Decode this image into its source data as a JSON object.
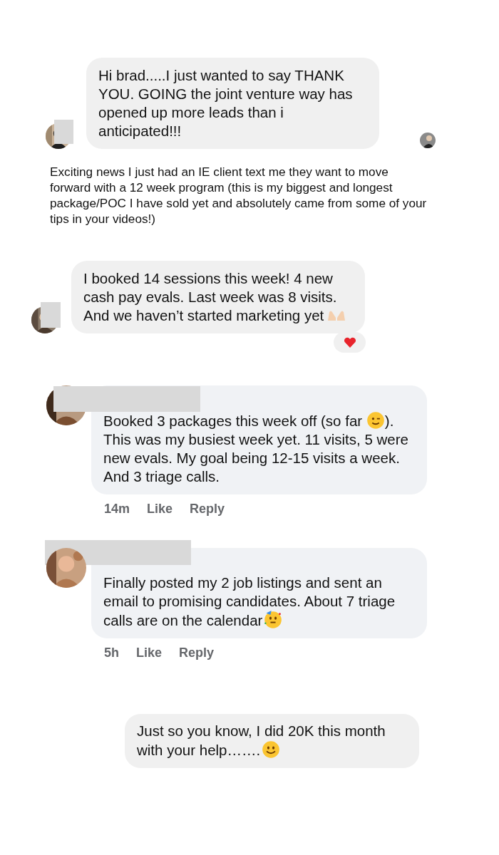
{
  "messages": [
    {
      "kind": "chat_bubble",
      "segments": [
        "Hi brad.....I just wanted to say THANK YOU. GOING the joint venture way has opened up more leads than i anticipated!!!"
      ],
      "ends_with_emoji": false,
      "avatar_redacted": true,
      "seen_avatar": true,
      "reacted": false
    },
    {
      "kind": "plain_text",
      "segments": [
        "Exciting news I just had an IE client text me they want to move forward with a 12 week program (this is my biggest and longest package/POC I have sold yet and absolutely came from some of your tips in your videos!)"
      ]
    },
    {
      "kind": "chat_bubble",
      "segments": [
        "I booked 14 sessions this week! 4 new cash pay evals. Last week was 8 visits. And we haven’t started marketing yet"
      ],
      "ends_with_emoji": true,
      "avatar_redacted": true,
      "seen_avatar": false,
      "reacted": true
    },
    {
      "kind": "comment",
      "segments": [
        "Booked 3 packages this week off (so far ",
        "). This was my busiest week yet. 11 visits, 5 were new evals. My goal being 12-15 visits a week.\nAnd 3 triage calls."
      ],
      "ends_with_emoji": false,
      "name_redacted": true,
      "time": "14m",
      "actions": [
        "Like",
        "Reply"
      ]
    },
    {
      "kind": "comment",
      "segments": [
        "Finally posted my 2 job listings and sent an email to promising candidates. About 7 triage calls are on the calendar"
      ],
      "ends_with_emoji": true,
      "name_redacted": true,
      "time": "5h",
      "actions": [
        "Like",
        "Reply"
      ]
    },
    {
      "kind": "sent_bubble",
      "segments": [
        "Just so you know, I did 20K this month with your help……."
      ],
      "ends_with_emoji": true
    }
  ]
}
